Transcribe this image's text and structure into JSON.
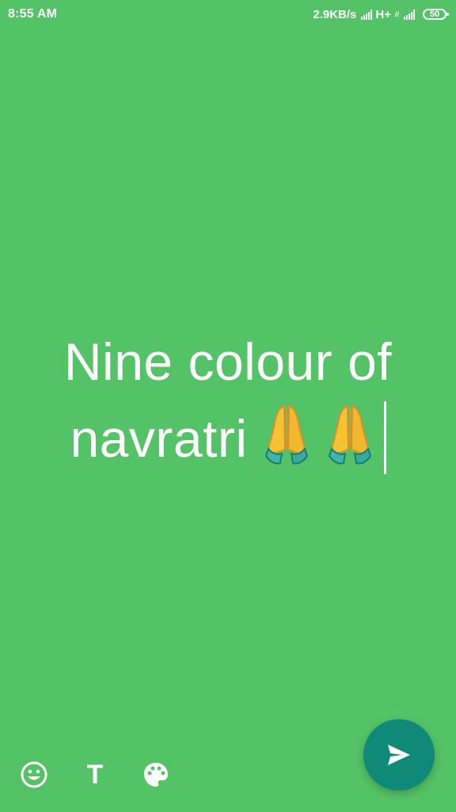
{
  "status_bar": {
    "time": "8:55 AM",
    "network_speed": "2.9KB/s",
    "network_type": "H+",
    "battery": "50"
  },
  "status_editor": {
    "background_color": "#54c266",
    "text_line_1": "Nine colour of",
    "text_line_2": "navratri",
    "emoji": [
      "folded-hands",
      "folded-hands"
    ]
  },
  "toolbar": {
    "emoji_icon": "smiley-icon",
    "text_label": "T",
    "palette_icon": "palette-icon"
  },
  "send_button": {
    "icon": "send-arrow-icon",
    "color": "#0f8a78"
  }
}
